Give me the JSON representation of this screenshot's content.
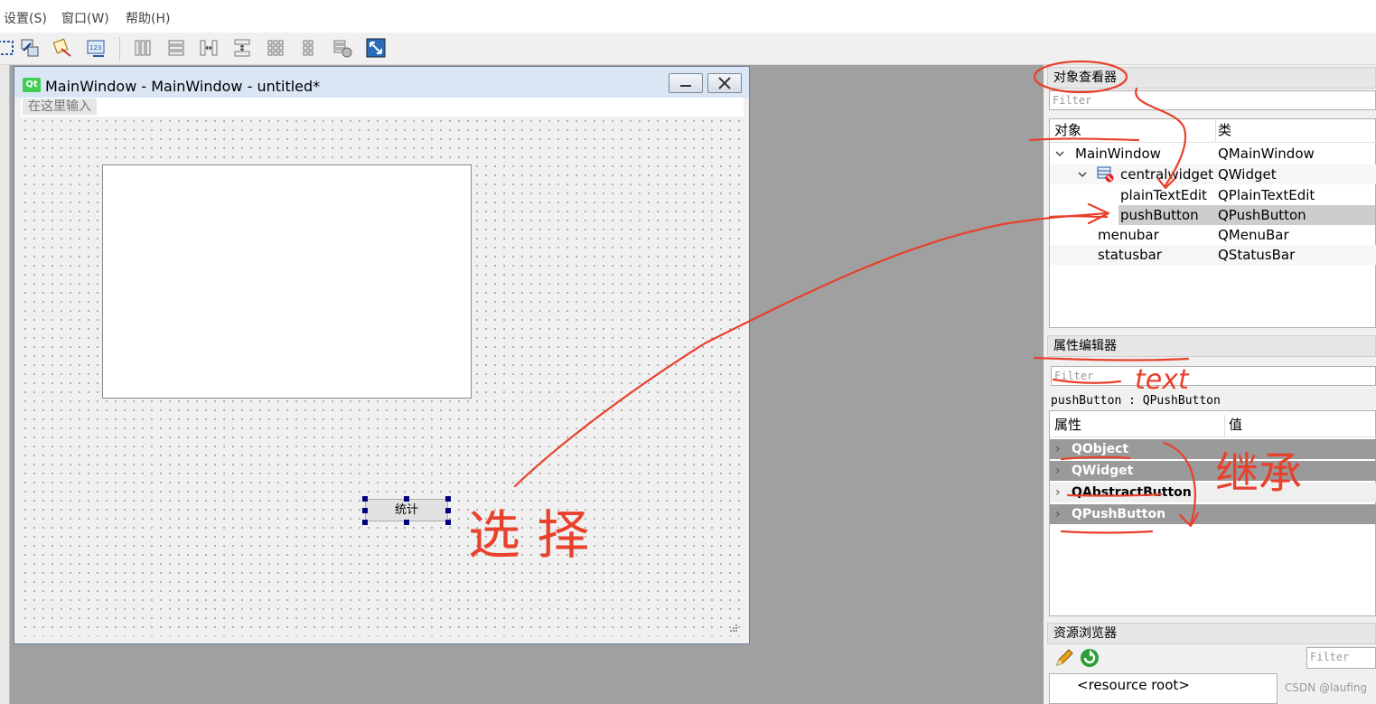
{
  "menubar": {
    "items": [
      "设置(S)",
      "窗口(W)",
      "帮助(H)"
    ]
  },
  "toolbar": {
    "icons": [
      "edit-widgets-icon",
      "edit-signals-slots-icon",
      "edit-buddies-icon",
      "edit-tab-order-icon",
      "layout-horizontal-icon",
      "layout-vertical-icon",
      "layout-horizontal-splitter-icon",
      "layout-vertical-splitter-icon",
      "layout-grid-icon",
      "layout-form-icon",
      "break-layout-icon",
      "adjust-size-icon"
    ]
  },
  "form_window": {
    "logo": "Qt",
    "title": "MainWindow - MainWindow - untitled*",
    "menu_placeholder": "在这里输入",
    "push_button_text": "统计"
  },
  "object_inspector": {
    "title": "对象查看器",
    "filter_placeholder": "Filter",
    "columns": [
      "对象",
      "类"
    ],
    "rows": [
      {
        "object": "MainWindow",
        "class": "QMainWindow"
      },
      {
        "object": "centralwidget",
        "class": "QWidget"
      },
      {
        "object": "plainTextEdit",
        "class": "QPlainTextEdit"
      },
      {
        "object": "pushButton",
        "class": "QPushButton"
      },
      {
        "object": "menubar",
        "class": "QMenuBar"
      },
      {
        "object": "statusbar",
        "class": "QStatusBar"
      }
    ]
  },
  "property_editor": {
    "title": "属性编辑器",
    "filter_placeholder": "Filter",
    "selected": "pushButton : QPushButton",
    "columns": [
      "属性",
      "值"
    ],
    "groups": [
      "QObject",
      "QWidget",
      "QAbstractButton",
      "QPushButton"
    ]
  },
  "resource_browser": {
    "title": "资源浏览器",
    "filter_placeholder": "Filter",
    "root": "<resource root>"
  },
  "annotations": {
    "select": "选 择",
    "text": "text",
    "inherit": "继承",
    "color": "#e8412c"
  },
  "watermark": "CSDN @laufing"
}
